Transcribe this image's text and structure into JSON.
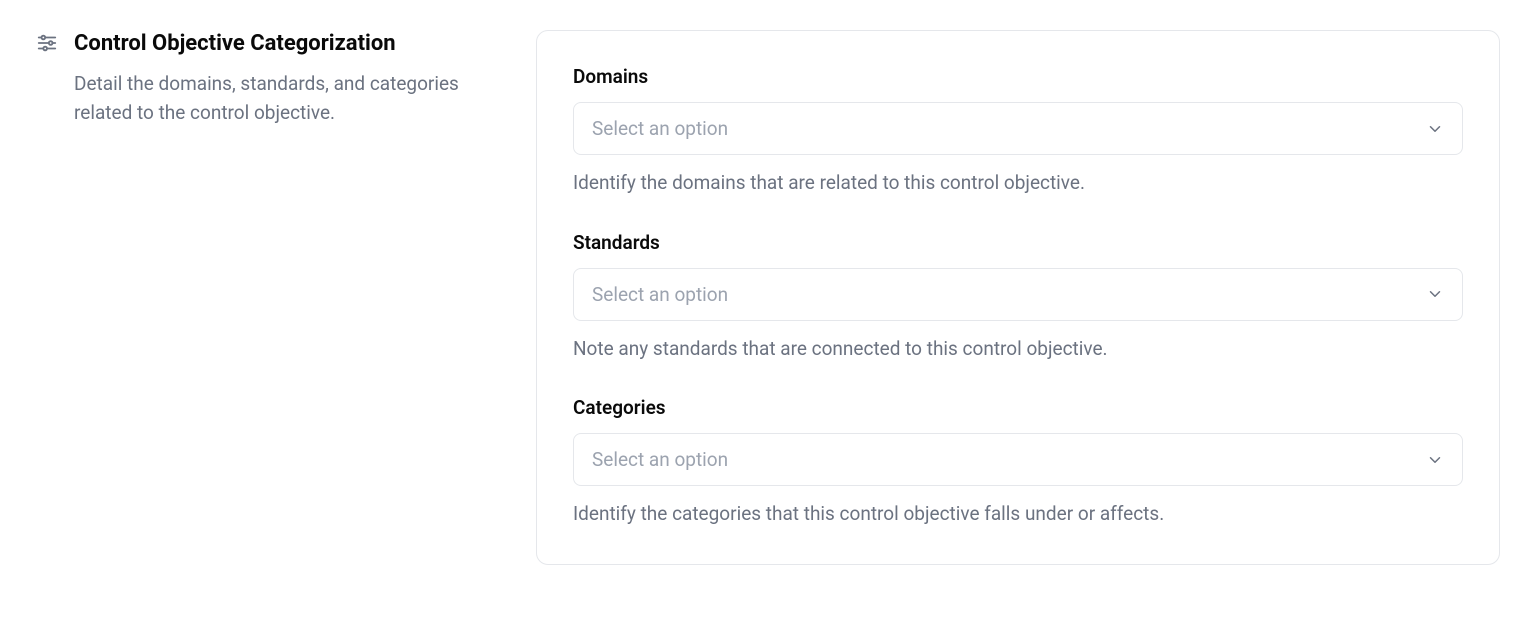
{
  "side": {
    "title": "Control Objective Categorization",
    "description": "Detail the domains, standards, and categories related to the control objective."
  },
  "fields": {
    "domains": {
      "label": "Domains",
      "placeholder": "Select an option",
      "help": "Identify the domains that are related to this control objective."
    },
    "standards": {
      "label": "Standards",
      "placeholder": "Select an option",
      "help": "Note any standards that are connected to this control objective."
    },
    "categories": {
      "label": "Categories",
      "placeholder": "Select an option",
      "help": "Identify the categories that this control objective falls under or affects."
    }
  }
}
